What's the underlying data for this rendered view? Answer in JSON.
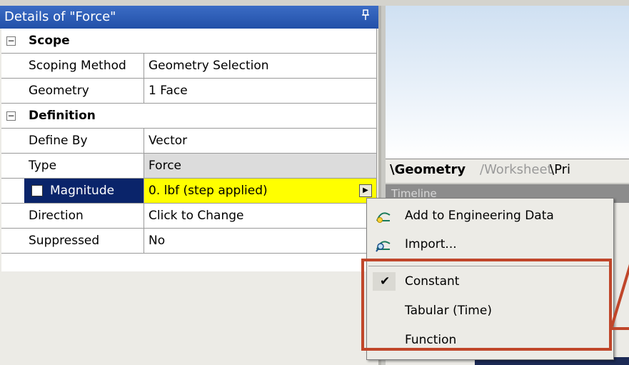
{
  "panel": {
    "title": "Details of \"Force\"",
    "pin_glyph": "ᵩ"
  },
  "rows": {
    "scope": {
      "label": "Scope",
      "expander": "−"
    },
    "scoping_method": {
      "prop": "Scoping Method",
      "value": "Geometry Selection"
    },
    "geometry": {
      "prop": "Geometry",
      "value": "1 Face"
    },
    "definition": {
      "label": "Definition",
      "expander": "−"
    },
    "define_by": {
      "prop": "Define By",
      "value": "Vector"
    },
    "type": {
      "prop": "Type",
      "value": "Force"
    },
    "magnitude": {
      "prop": "Magnitude",
      "value": "0. lbf  (step applied)",
      "flyout": "▶"
    },
    "direction": {
      "prop": "Direction",
      "value": "Click to Change"
    },
    "suppressed": {
      "prop": "Suppressed",
      "value": "No"
    }
  },
  "tabs": {
    "geometry": "\\Geometry",
    "worksheet": "/Worksheet",
    "print": "\\Pri"
  },
  "timeline": {
    "label": "Timeline"
  },
  "menu": {
    "add_engineering_data": "Add to Engineering Data",
    "import": "Import...",
    "constant": "Constant",
    "constant_check": "✔",
    "tabular": "Tabular (Time)",
    "function": "Function"
  },
  "colors": {
    "title_bar": "#2250a8",
    "selected_row": "#0a246a",
    "highlight_value": "#ffff00",
    "annotation_box": "#c0462a"
  }
}
